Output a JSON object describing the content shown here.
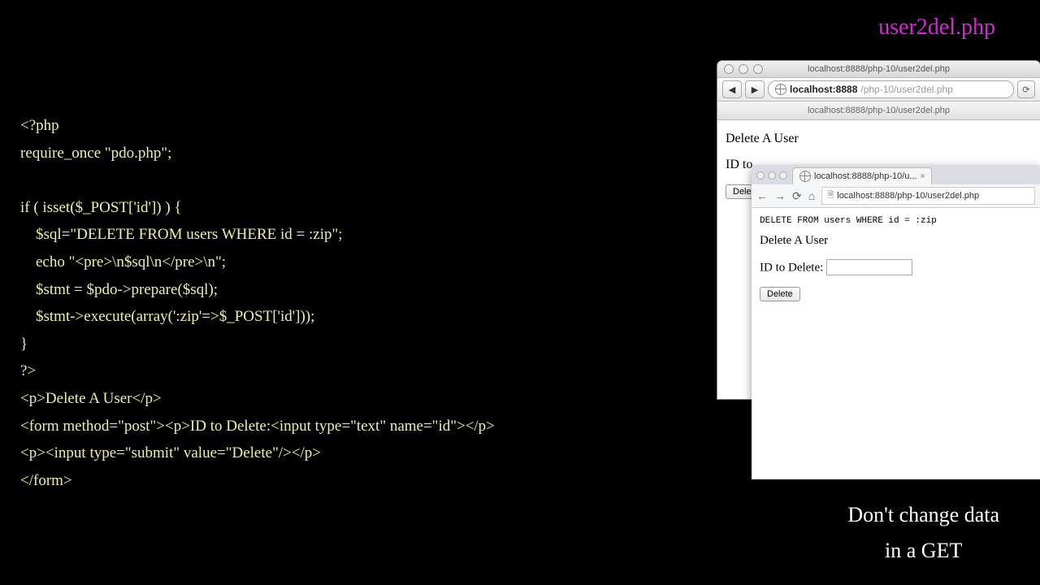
{
  "filename": "user2del.php",
  "code": "<?php\nrequire_once \"pdo.php\";\n\nif ( isset($_POST['id']) ) {\n    $sql=\"DELETE FROM users WHERE id = :zip\";\n    echo \"<pre>\\n$sql\\n</pre>\\n\";\n    $stmt = $pdo->prepare($sql);\n    $stmt->execute(array(':zip'=>$_POST['id']));\n}\n?>\n<p>Delete A User</p>\n<form method=\"post\"><p>ID to Delete:<input type=\"text\" name=\"id\"></p>\n<p><input type=\"submit\" value=\"Delete\"/></p>\n</form>",
  "footer": {
    "line1": "Don't change data",
    "line2": "in a GET"
  },
  "browser1": {
    "title": "localhost:8888/php-10/user2del.php",
    "back": "◀",
    "fwd": "▶",
    "host": "localhost:8888",
    "path": "/php-10/user2del.php",
    "reload": "⟳",
    "tab": "localhost:8888/php-10/user2del.php",
    "body_heading": "Delete A User",
    "body_label": "ID to",
    "button": "Dele"
  },
  "browser2": {
    "tab_label": "localhost:8888/php-10/u...",
    "tab_close": "×",
    "back": "←",
    "fwd": "→",
    "reload": "⟳",
    "home": "⌂",
    "url": "localhost:8888/php-10/user2del.php",
    "sql_echo": "DELETE FROM users WHERE id = :zip",
    "heading": "Delete A User",
    "label": "ID to Delete:",
    "button": "Delete"
  }
}
